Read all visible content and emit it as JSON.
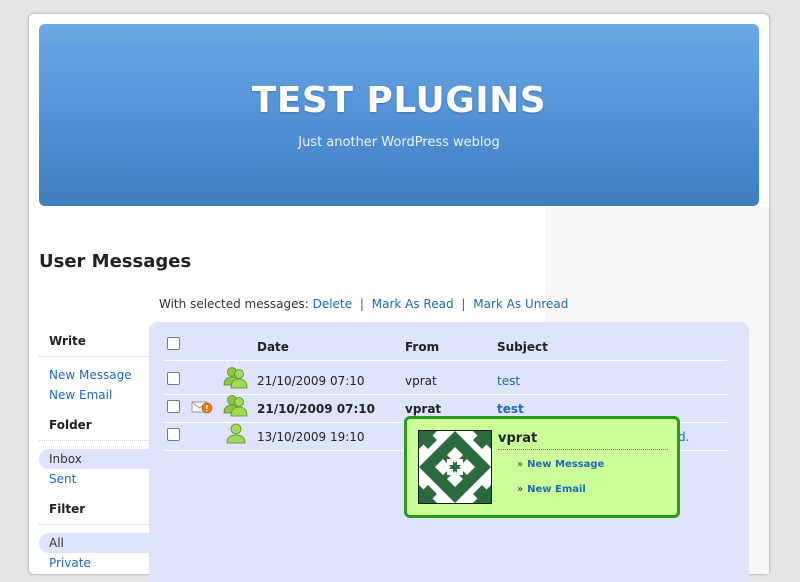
{
  "site": {
    "title": "TEST PLUGINS",
    "description": "Just another WordPress weblog"
  },
  "page_title": "User Messages",
  "bulk_actions": {
    "prefix": "With selected messages:",
    "delete": "Delete",
    "mark_read": "Mark As Read",
    "mark_unread": "Mark As Unread",
    "separator": "|"
  },
  "sidebar": {
    "write_heading": "Write",
    "write_items": [
      "New Message",
      "New Email"
    ],
    "folder_heading": "Folder",
    "folder_items": [
      "Inbox",
      "Sent"
    ],
    "filter_heading": "Filter",
    "filter_items": [
      "All",
      "Private"
    ]
  },
  "table": {
    "headers": {
      "date": "Date",
      "from": "From",
      "subject": "Subject"
    },
    "rows": [
      {
        "date": "21/10/2009 07:10",
        "from": "vprat",
        "subject": "test",
        "unread": false,
        "icon": "users-group-icon"
      },
      {
        "date": "21/10/2009 07:10",
        "from": "vprat",
        "subject": "test",
        "unread": true,
        "icon": "users-group-icon",
        "flag": "new-mail-alert-icon"
      },
      {
        "date": "13/10/2009 19:10",
        "from": "",
        "subject": "",
        "unread": false,
        "icon": "user-single-icon"
      }
    ],
    "row3_tail_text": "d."
  },
  "user_popup": {
    "name": "vprat",
    "links": [
      "New Message",
      "New Email"
    ],
    "raquo": "»"
  },
  "colors": {
    "header_top": "#6aaae6",
    "header_bottom": "#3f7dbd",
    "panel_bg": "#dfe3fb",
    "link": "#1e6ab8",
    "popup_bg": "#ccff99",
    "popup_border": "#2b9a1c",
    "identicon": "#2b6a3e"
  }
}
